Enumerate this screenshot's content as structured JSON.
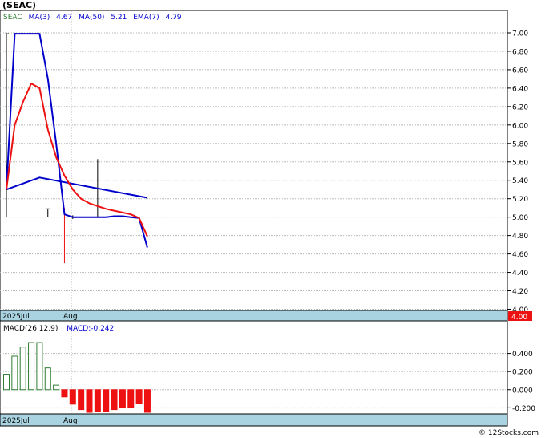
{
  "title": "(SEAC)",
  "legend": {
    "ticker": "SEAC",
    "ma3_label": "MA(3)",
    "ma3_value": "4.67",
    "ma50_label": "MA(50)",
    "ma50_value": "5.21",
    "ema7_label": "EMA(7)",
    "ema7_value": "4.79"
  },
  "macd_legend": {
    "label": "MACD(26,12,9)",
    "value_label": "MACD:-0.242"
  },
  "price_badge": "4.00",
  "x_labels": [
    "2025Jul",
    "Aug"
  ],
  "footer": "© 12Stocks.com",
  "colors": {
    "ma3": "#0000cc",
    "ma50": "#0000cc",
    "ema7": "#ee1111",
    "up_bar": "#2e7d32",
    "down_bar": "#ee1111",
    "axis_band": "#a9d3e0"
  },
  "chart_data": [
    {
      "type": "line",
      "ylim": [
        4.0,
        7.1
      ],
      "yticks": [
        "7.00",
        "6.80",
        "6.60",
        "6.40",
        "6.20",
        "6.00",
        "5.80",
        "5.60",
        "5.40",
        "5.20",
        "5.00",
        "4.80",
        "4.60",
        "4.40",
        "4.20",
        "4.00"
      ],
      "candles": [
        {
          "i": 0,
          "open": 5.35,
          "high": 6.99,
          "low": 5.0,
          "close": 6.99
        },
        {
          "i": 5,
          "open": 5.09,
          "high": 5.09,
          "low": 5.0,
          "close": 5.09
        },
        {
          "i": 7,
          "open": 5.09,
          "high": 5.1,
          "low": 4.5,
          "close": 5.0
        },
        {
          "i": 8,
          "open": 5.0,
          "high": 5.02,
          "low": 4.98,
          "close": 5.0
        },
        {
          "i": 11,
          "open": 5.0,
          "high": 5.63,
          "low": 5.0,
          "close": 5.0
        }
      ],
      "series": [
        {
          "name": "MA(3)",
          "x": [
            0,
            1,
            2,
            3,
            4,
            5,
            6,
            7,
            8,
            9,
            10,
            11,
            12,
            13,
            14,
            15,
            16,
            17
          ],
          "y": [
            5.3,
            6.99,
            6.99,
            6.99,
            6.99,
            6.5,
            5.8,
            5.03,
            5.0,
            5.0,
            5.0,
            5.0,
            5.0,
            5.01,
            5.01,
            5.0,
            4.99,
            4.67
          ]
        },
        {
          "name": "MA(50)",
          "x": [
            0,
            4,
            17
          ],
          "y": [
            5.3,
            5.43,
            5.21
          ]
        },
        {
          "name": "EMA(7)",
          "x": [
            0,
            1,
            2,
            3,
            4,
            5,
            6,
            7,
            8,
            9,
            10,
            11,
            12,
            13,
            14,
            15,
            16,
            17
          ],
          "y": [
            5.3,
            6.0,
            6.25,
            6.45,
            6.4,
            5.95,
            5.65,
            5.45,
            5.3,
            5.2,
            5.15,
            5.12,
            5.09,
            5.07,
            5.05,
            5.03,
            4.99,
            4.79
          ]
        }
      ]
    },
    {
      "type": "bar",
      "ylim": [
        -0.25,
        0.6
      ],
      "yticks": [
        "0.400",
        "0.200",
        "0.000",
        "-0.200"
      ],
      "x": [
        0,
        1,
        2,
        3,
        4,
        5,
        6,
        7,
        8,
        9,
        10,
        11,
        12,
        13,
        14,
        15,
        16,
        17
      ],
      "values": [
        0.17,
        0.37,
        0.47,
        0.52,
        0.52,
        0.24,
        0.05,
        -0.08,
        -0.16,
        -0.22,
        -0.25,
        -0.24,
        -0.24,
        -0.22,
        -0.2,
        -0.2,
        -0.15,
        -0.25
      ]
    }
  ]
}
